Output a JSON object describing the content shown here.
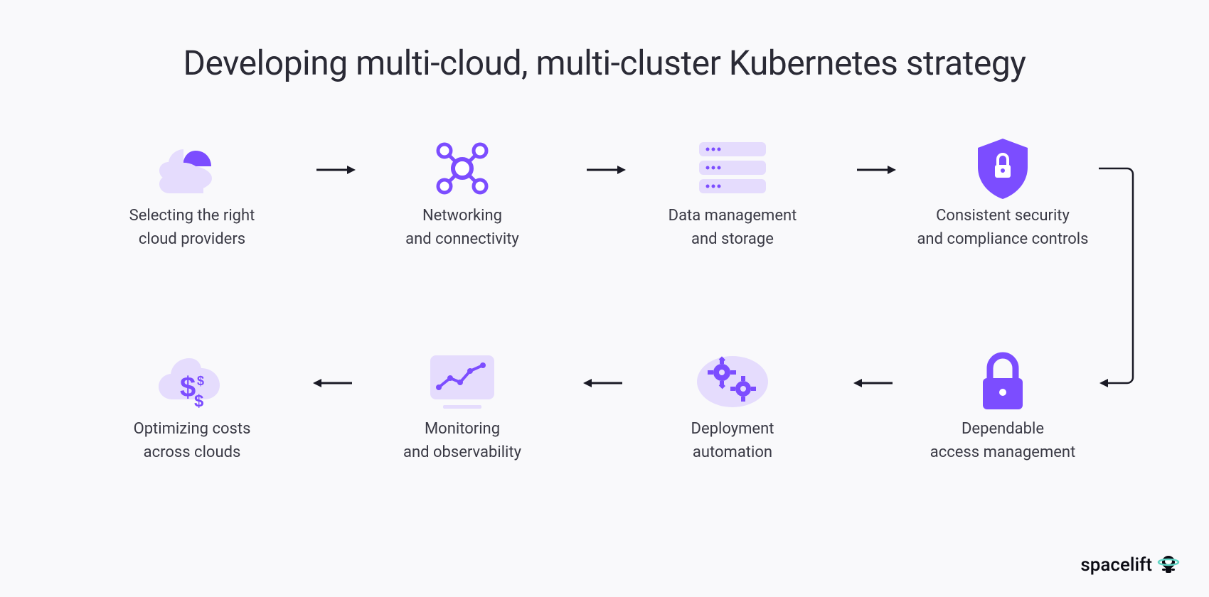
{
  "title": "Developing multi-cloud, multi-cluster Kubernetes strategy",
  "steps": [
    {
      "label": "Selecting the right\ncloud providers"
    },
    {
      "label": "Networking\nand connectivity"
    },
    {
      "label": "Data management\nand storage"
    },
    {
      "label": "Consistent security\nand compliance controls"
    },
    {
      "label": "Dependable\naccess management"
    },
    {
      "label": "Deployment\nautomation"
    },
    {
      "label": "Monitoring\nand observability"
    },
    {
      "label": "Optimizing costs\nacross clouds"
    }
  ],
  "brand": "spacelift",
  "colors": {
    "accent": "#7c4dff",
    "accentLight": "#e5dcfd",
    "text": "#2a2a35"
  }
}
